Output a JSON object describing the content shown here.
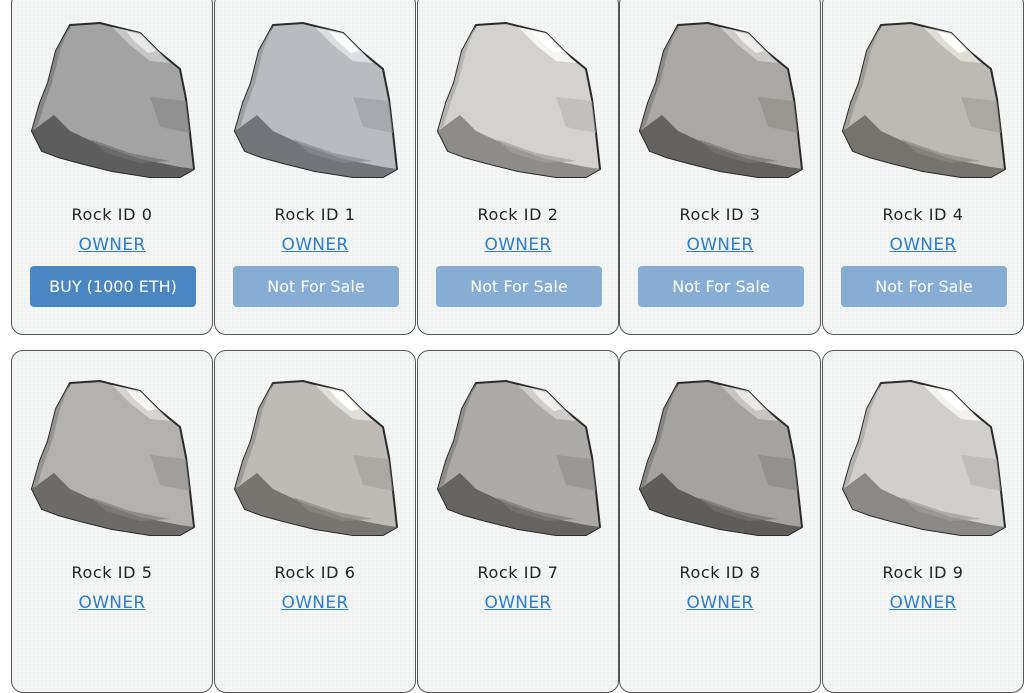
{
  "rocks": [
    {
      "title": "Rock ID 0",
      "owner_label": "OWNER",
      "button_label": "BUY (1000 ETH)",
      "button_type": "buy",
      "shade": "#a3a3a3"
    },
    {
      "title": "Rock ID 1",
      "owner_label": "OWNER",
      "button_label": "Not For Sale",
      "button_type": "nfs",
      "shade": "#b8bcc0"
    },
    {
      "title": "Rock ID 2",
      "owner_label": "OWNER",
      "button_label": "Not For Sale",
      "button_type": "nfs",
      "shade": "#d3d2ce"
    },
    {
      "title": "Rock ID 3",
      "owner_label": "OWNER",
      "button_label": "Not For Sale",
      "button_type": "nfs",
      "shade": "#aaa8a4"
    },
    {
      "title": "Rock ID 4",
      "owner_label": "OWNER",
      "button_label": "Not For Sale",
      "button_type": "nfs",
      "shade": "#bdbab4"
    },
    {
      "title": "Rock ID 5",
      "owner_label": "OWNER",
      "button_label": "",
      "button_type": "none",
      "shade": "#b3b1ae"
    },
    {
      "title": "Rock ID 6",
      "owner_label": "OWNER",
      "button_label": "",
      "button_type": "none",
      "shade": "#bebbb6"
    },
    {
      "title": "Rock ID 7",
      "owner_label": "OWNER",
      "button_label": "",
      "button_type": "none",
      "shade": "#acaaa6"
    },
    {
      "title": "Rock ID 8",
      "owner_label": "OWNER",
      "button_label": "",
      "button_type": "none",
      "shade": "#a5a3a0"
    },
    {
      "title": "Rock ID 9",
      "owner_label": "OWNER",
      "button_label": "",
      "button_type": "none",
      "shade": "#d0cfcb"
    }
  ],
  "colors": {
    "buy_button": "#4a86c2",
    "not_for_sale_button": "#86aed4",
    "owner_link": "#2e7fc9"
  }
}
